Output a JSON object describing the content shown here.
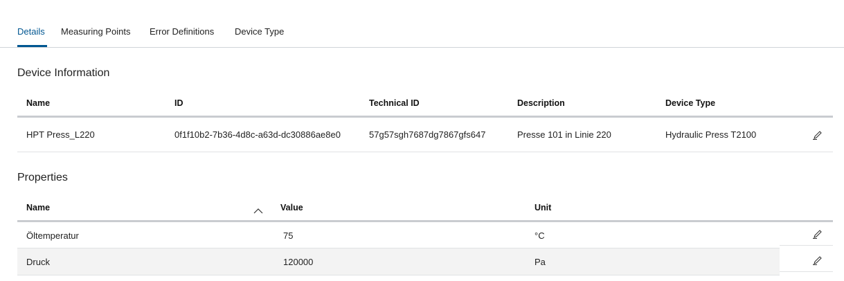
{
  "tabs": [
    {
      "label": "Details",
      "active": true
    },
    {
      "label": "Measuring Points",
      "active": false
    },
    {
      "label": "Error Definitions",
      "active": false
    },
    {
      "label": "Device Type",
      "active": false
    }
  ],
  "device_info": {
    "title": "Device Information",
    "headers": {
      "name": "Name",
      "id": "ID",
      "technical_id": "Technical ID",
      "description": "Description",
      "device_type": "Device Type"
    },
    "row": {
      "name": "HPT Press_L220",
      "id": "0f1f10b2-7b36-4d8c-a63d-dc30886ae8e0",
      "technical_id": "57g57sgh7687dg7867gfs647",
      "description": "Presse 101 in Linie 220",
      "device_type": "Hydraulic Press T2100"
    }
  },
  "properties": {
    "title": "Properties",
    "headers": {
      "name": "Name",
      "value": "Value",
      "unit": "Unit"
    },
    "rows": [
      {
        "name": "Öltemperatur",
        "value": "75",
        "unit": "°C"
      },
      {
        "name": "Druck",
        "value": "120000",
        "unit": "Pa"
      }
    ]
  },
  "icons": {
    "edit": "pencil-icon",
    "sort": "chevron-up-icon"
  },
  "colors": {
    "accent": "#005691",
    "stripe": "#f3f3f3",
    "header_rule": "#c9ccd0"
  }
}
